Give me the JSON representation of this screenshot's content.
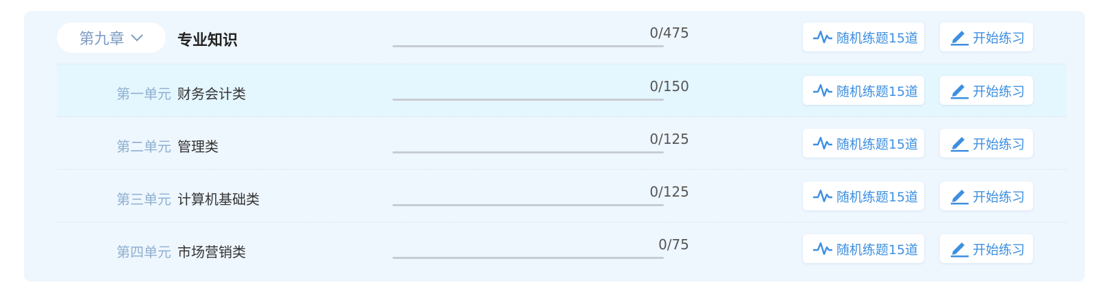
{
  "chapter": {
    "label": "第九章",
    "title": "专业知识",
    "count": "0/475",
    "progress": 0,
    "random_label": "随机练题15道",
    "start_label": "开始练习"
  },
  "units": [
    {
      "label": "第一单元",
      "name": "财务会计类",
      "count": "0/150",
      "progress": 0,
      "random_label": "随机练题15道",
      "start_label": "开始练习"
    },
    {
      "label": "第二单元",
      "name": "管理类",
      "count": "0/125",
      "progress": 0,
      "random_label": "随机练题15道",
      "start_label": "开始练习"
    },
    {
      "label": "第三单元",
      "name": "计算机基础类",
      "count": "0/125",
      "progress": 0,
      "random_label": "随机练题15道",
      "start_label": "开始练习"
    },
    {
      "label": "第四单元",
      "name": "市场营销类",
      "count": "0/75",
      "progress": 0,
      "random_label": "随机练题15道",
      "start_label": "开始练习"
    }
  ],
  "colors": {
    "accent": "#3d8fe0",
    "panel_bg": "#eef6fe",
    "highlight_row": "#e4f6fe",
    "unit_label": "#8fb0d0"
  },
  "icons": {
    "random": "pulse-icon",
    "start": "pencil-icon",
    "dropdown": "chevron-down-icon"
  }
}
